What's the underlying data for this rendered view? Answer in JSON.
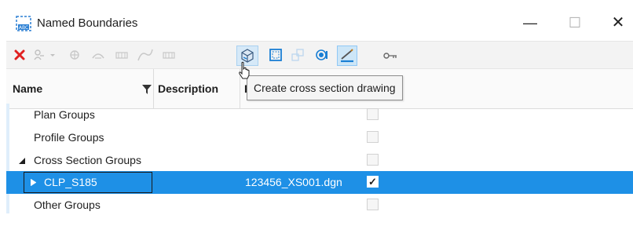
{
  "window": {
    "title": "Named Boundaries",
    "minimize": "—",
    "maximize": "☐",
    "close": "✕"
  },
  "toolbar": {
    "buttons": [
      {
        "name": "delete",
        "icon": "delete-x-icon",
        "color": "#e02020"
      },
      {
        "name": "filter",
        "icon": "filter-dropdown-icon"
      },
      {
        "name": "group",
        "icon": "group-icon"
      },
      {
        "name": "civil-plan",
        "icon": "plan-icon"
      },
      {
        "name": "sheet",
        "icon": "sheet-icon"
      },
      {
        "name": "profile",
        "icon": "profile-curve-icon"
      },
      {
        "name": "sheet-2",
        "icon": "sheet-icon"
      },
      {
        "name": "create-cross-section-drawing",
        "icon": "cube-icon"
      },
      {
        "name": "frame",
        "icon": "frame-icon"
      },
      {
        "name": "modify",
        "icon": "modify-icon"
      },
      {
        "name": "view",
        "icon": "view-icon"
      },
      {
        "name": "draw",
        "icon": "pencil-icon"
      },
      {
        "name": "key",
        "icon": "key-icon"
      }
    ]
  },
  "tooltip": "Create cross section drawing",
  "columns": {
    "name": "Name",
    "description": "Description",
    "file_initial": "F"
  },
  "tree": [
    {
      "label": "Plan Groups",
      "checked": false
    },
    {
      "label": "Profile Groups",
      "checked": false
    },
    {
      "label": "Cross Section Groups",
      "checked": false,
      "expanded": true
    },
    {
      "label": "CLP_S185",
      "file": "123456_XS001.dgn",
      "checked": true,
      "selected": true
    },
    {
      "label": "Other Groups",
      "checked": false
    }
  ],
  "check_mark": "✓",
  "colors": {
    "selection": "#1e90e6",
    "accent_icon": "#1a7fd4"
  }
}
